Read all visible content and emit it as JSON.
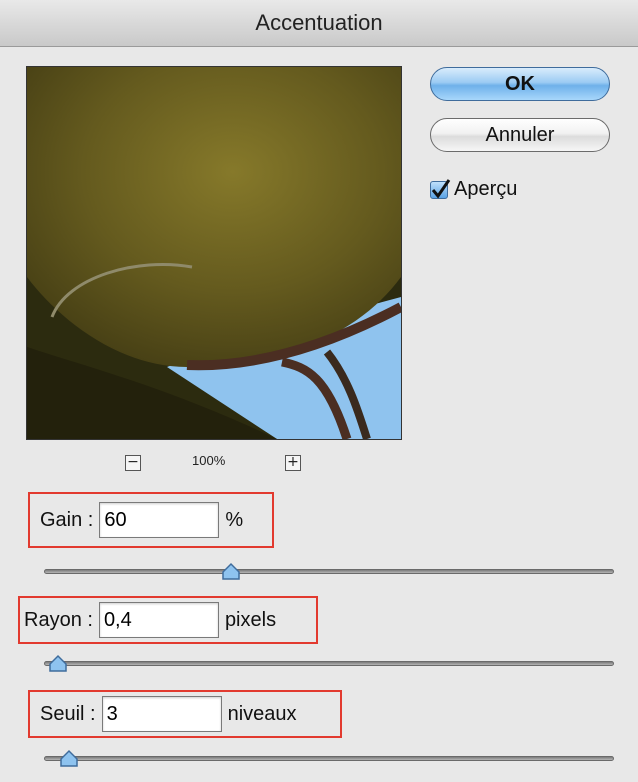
{
  "window": {
    "title": "Accentuation"
  },
  "preview": {
    "zoom_level": "100%",
    "zoom_out_symbol": "−",
    "zoom_in_symbol": "+"
  },
  "buttons": {
    "ok_label": "OK",
    "cancel_label": "Annuler"
  },
  "options": {
    "preview_label": "Aperçu",
    "preview_checked": true
  },
  "params": {
    "gain": {
      "label": "Gain :",
      "value": "60",
      "unit": "%",
      "slider_fraction": 0.32
    },
    "radius": {
      "label": "Rayon :",
      "value": "0,4",
      "unit": "pixels",
      "slider_fraction": 0.0
    },
    "threshold": {
      "label": "Seuil :",
      "value": "3",
      "unit": "niveaux",
      "slider_fraction": 0.02
    }
  },
  "colors": {
    "highlight_box": "#e23a2f",
    "ok_button": "#8cc3f0",
    "sky": "#8fc3ee"
  }
}
